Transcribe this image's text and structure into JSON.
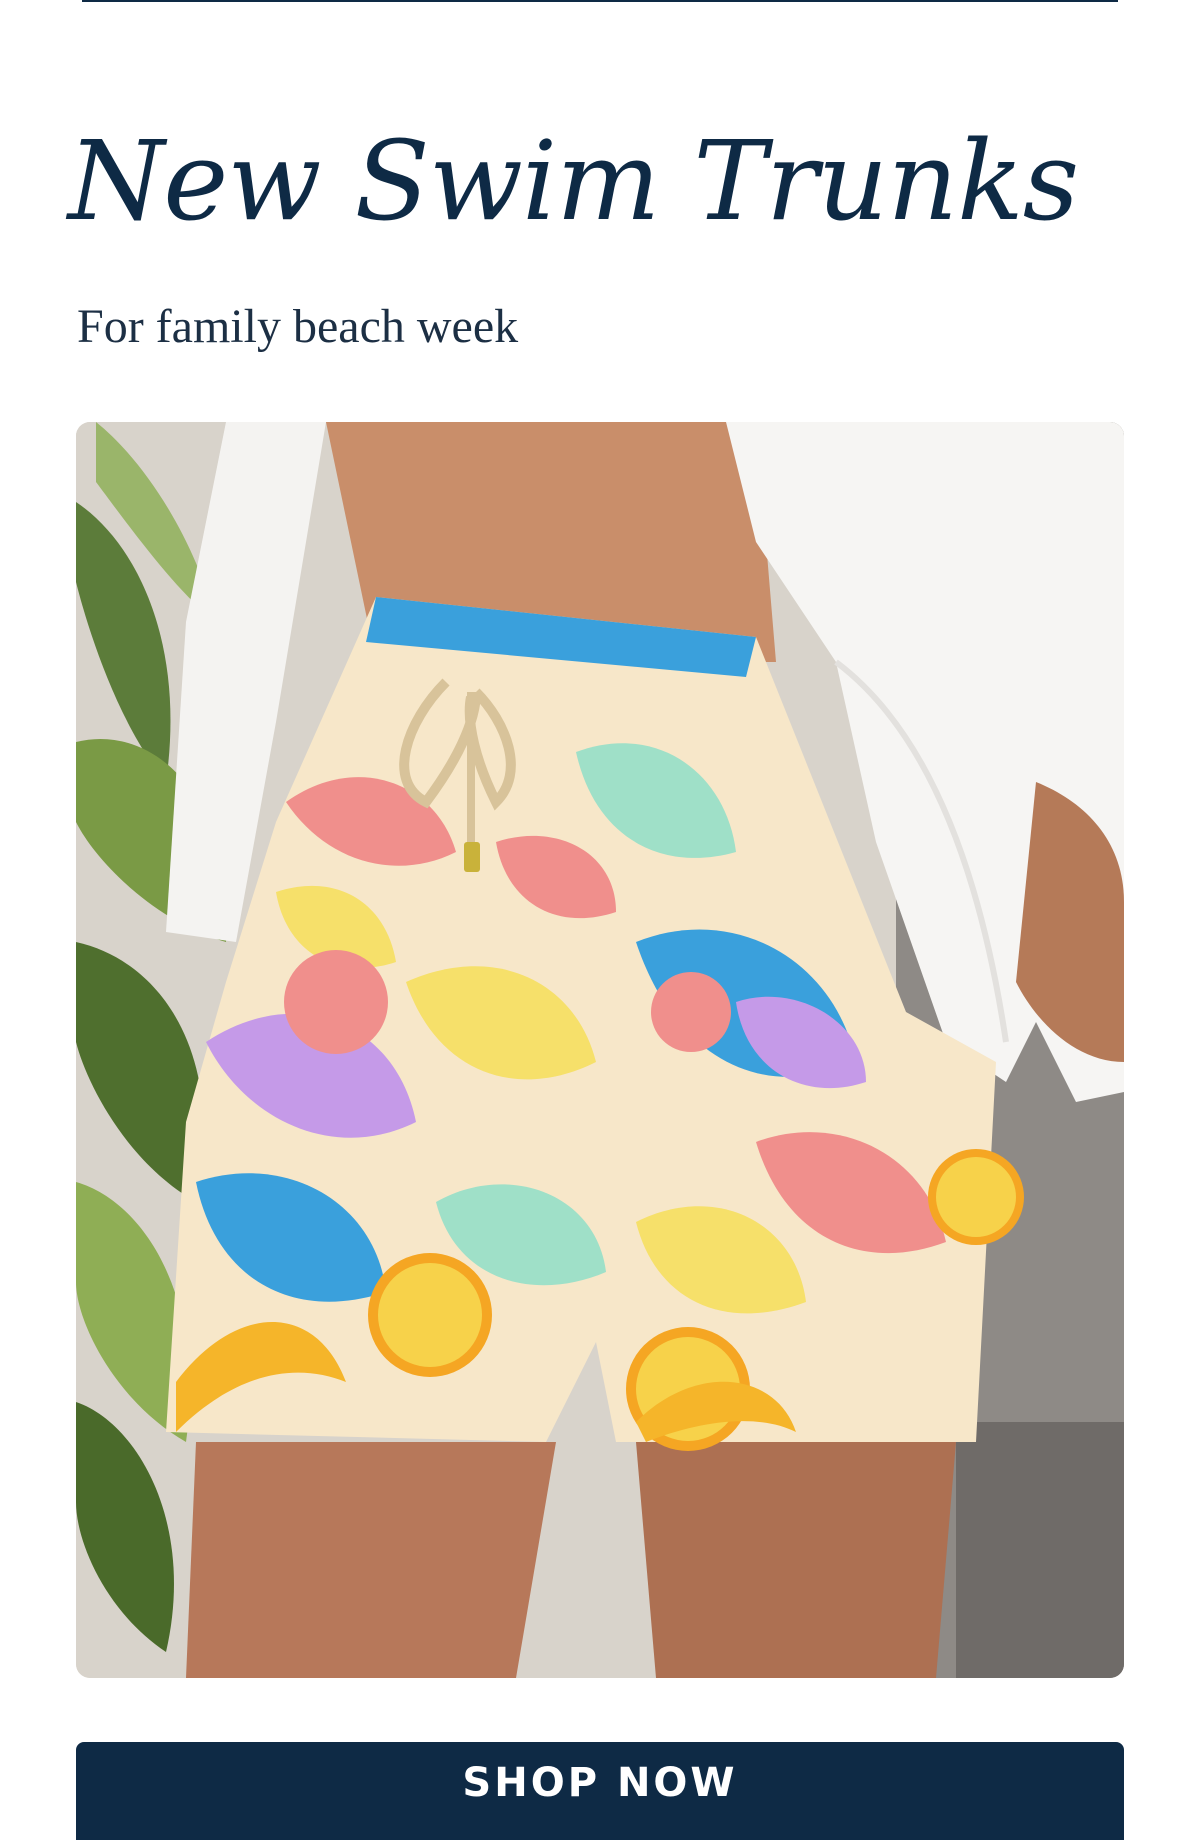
{
  "promo": {
    "headline": "New Swim Trunks",
    "subheadline": "For family beach week",
    "cta_label": "SHOP NOW"
  },
  "colors": {
    "navy": "#0e2a45",
    "white": "#ffffff",
    "coral": "#f08f8c",
    "sky_blue": "#3aa0dc",
    "lemon": "#f6e06a",
    "mint": "#9fe0c8",
    "lavender": "#c59ae8",
    "orange": "#f5a623"
  }
}
